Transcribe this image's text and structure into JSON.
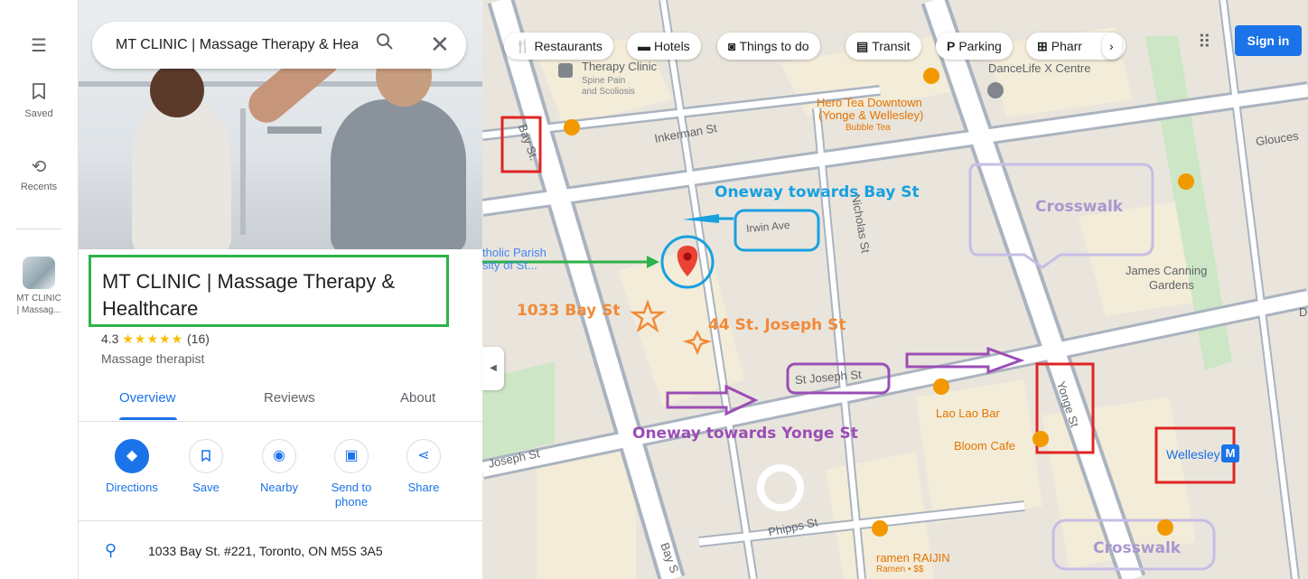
{
  "rail": {
    "saved_label": "Saved",
    "recents_label": "Recents",
    "recent_item_label_1": "MT CLINIC",
    "recent_item_label_2": "| Massag..."
  },
  "search": {
    "value": "MT CLINIC | Massage Therapy & Heal"
  },
  "place": {
    "title": "MT CLINIC | Massage Therapy & Healthcare",
    "rating": "4.3",
    "stars": "★★★★★",
    "review_count": "(16)",
    "category": "Massage therapist",
    "address": "1033 Bay St. #221, Toronto, ON M5S 3A5"
  },
  "tabs": [
    "Overview",
    "Reviews",
    "About"
  ],
  "actions": {
    "directions": "Directions",
    "save": "Save",
    "nearby": "Nearby",
    "send_to_phone_1": "Send to",
    "send_to_phone_2": "phone",
    "share": "Share"
  },
  "chips": {
    "restaurants": "Restaurants",
    "hotels": "Hotels",
    "things_to_do": "Things to do",
    "transit": "Transit",
    "parking": "Parking",
    "pharmacy": "Pharr"
  },
  "header": {
    "signin": "Sign in"
  },
  "map_labels": {
    "therapy_clinic": "Therapy Clinic",
    "therapy_clinic_sub1": "Spine Pain",
    "therapy_clinic_sub2": "and Scoliosis",
    "dancelife": "DanceLife X Centre",
    "hero_tea_1": "Hero Tea Downtown",
    "hero_tea_2": "(Yonge & Wellesley)",
    "hero_tea_sub": "Bubble Tea",
    "inkerman": "Inkerman St",
    "bay_st": "Bay St.",
    "bay_st_bottom": "Bay S",
    "irwin": "Irwin Ave",
    "nicholas": "Nicholas St",
    "glouces": "Glouces",
    "parish_1": "tholic Parish",
    "parish_2": "sity of St...",
    "james_canning_1": "James Canning",
    "james_canning_2": "Gardens",
    "st_joseph": "St Joseph St",
    "joseph_st": "Joseph St",
    "yonge": "Yonge St",
    "lao_lao": "Lao Lao Bar",
    "bloom": "Bloom Cafe",
    "wellesley": "Wellesley",
    "wellesley_badge": "M",
    "phipps": "Phipps St",
    "ramen": "ramen RAIJIN",
    "ramen_sub": "Ramen • $$",
    "right_edge_d": "D"
  },
  "annotations": {
    "oneway_bay": "Oneway towards Bay St",
    "crosswalk_top": "Crosswalk",
    "addr_1033": "1033 Bay St",
    "addr_44": "44 St. Joseph St",
    "oneway_yonge": "Oneway towards Yonge St",
    "crosswalk_bottom": "Crosswalk"
  },
  "colors": {
    "accent_blue": "#1a73e8",
    "annot_green": "#2db34a",
    "annot_red": "#e02424",
    "annot_blue": "#19a0e0",
    "annot_purple": "#9b4eb5",
    "annot_orange": "#f08a3a",
    "annot_lavender": "#c7bde6"
  }
}
